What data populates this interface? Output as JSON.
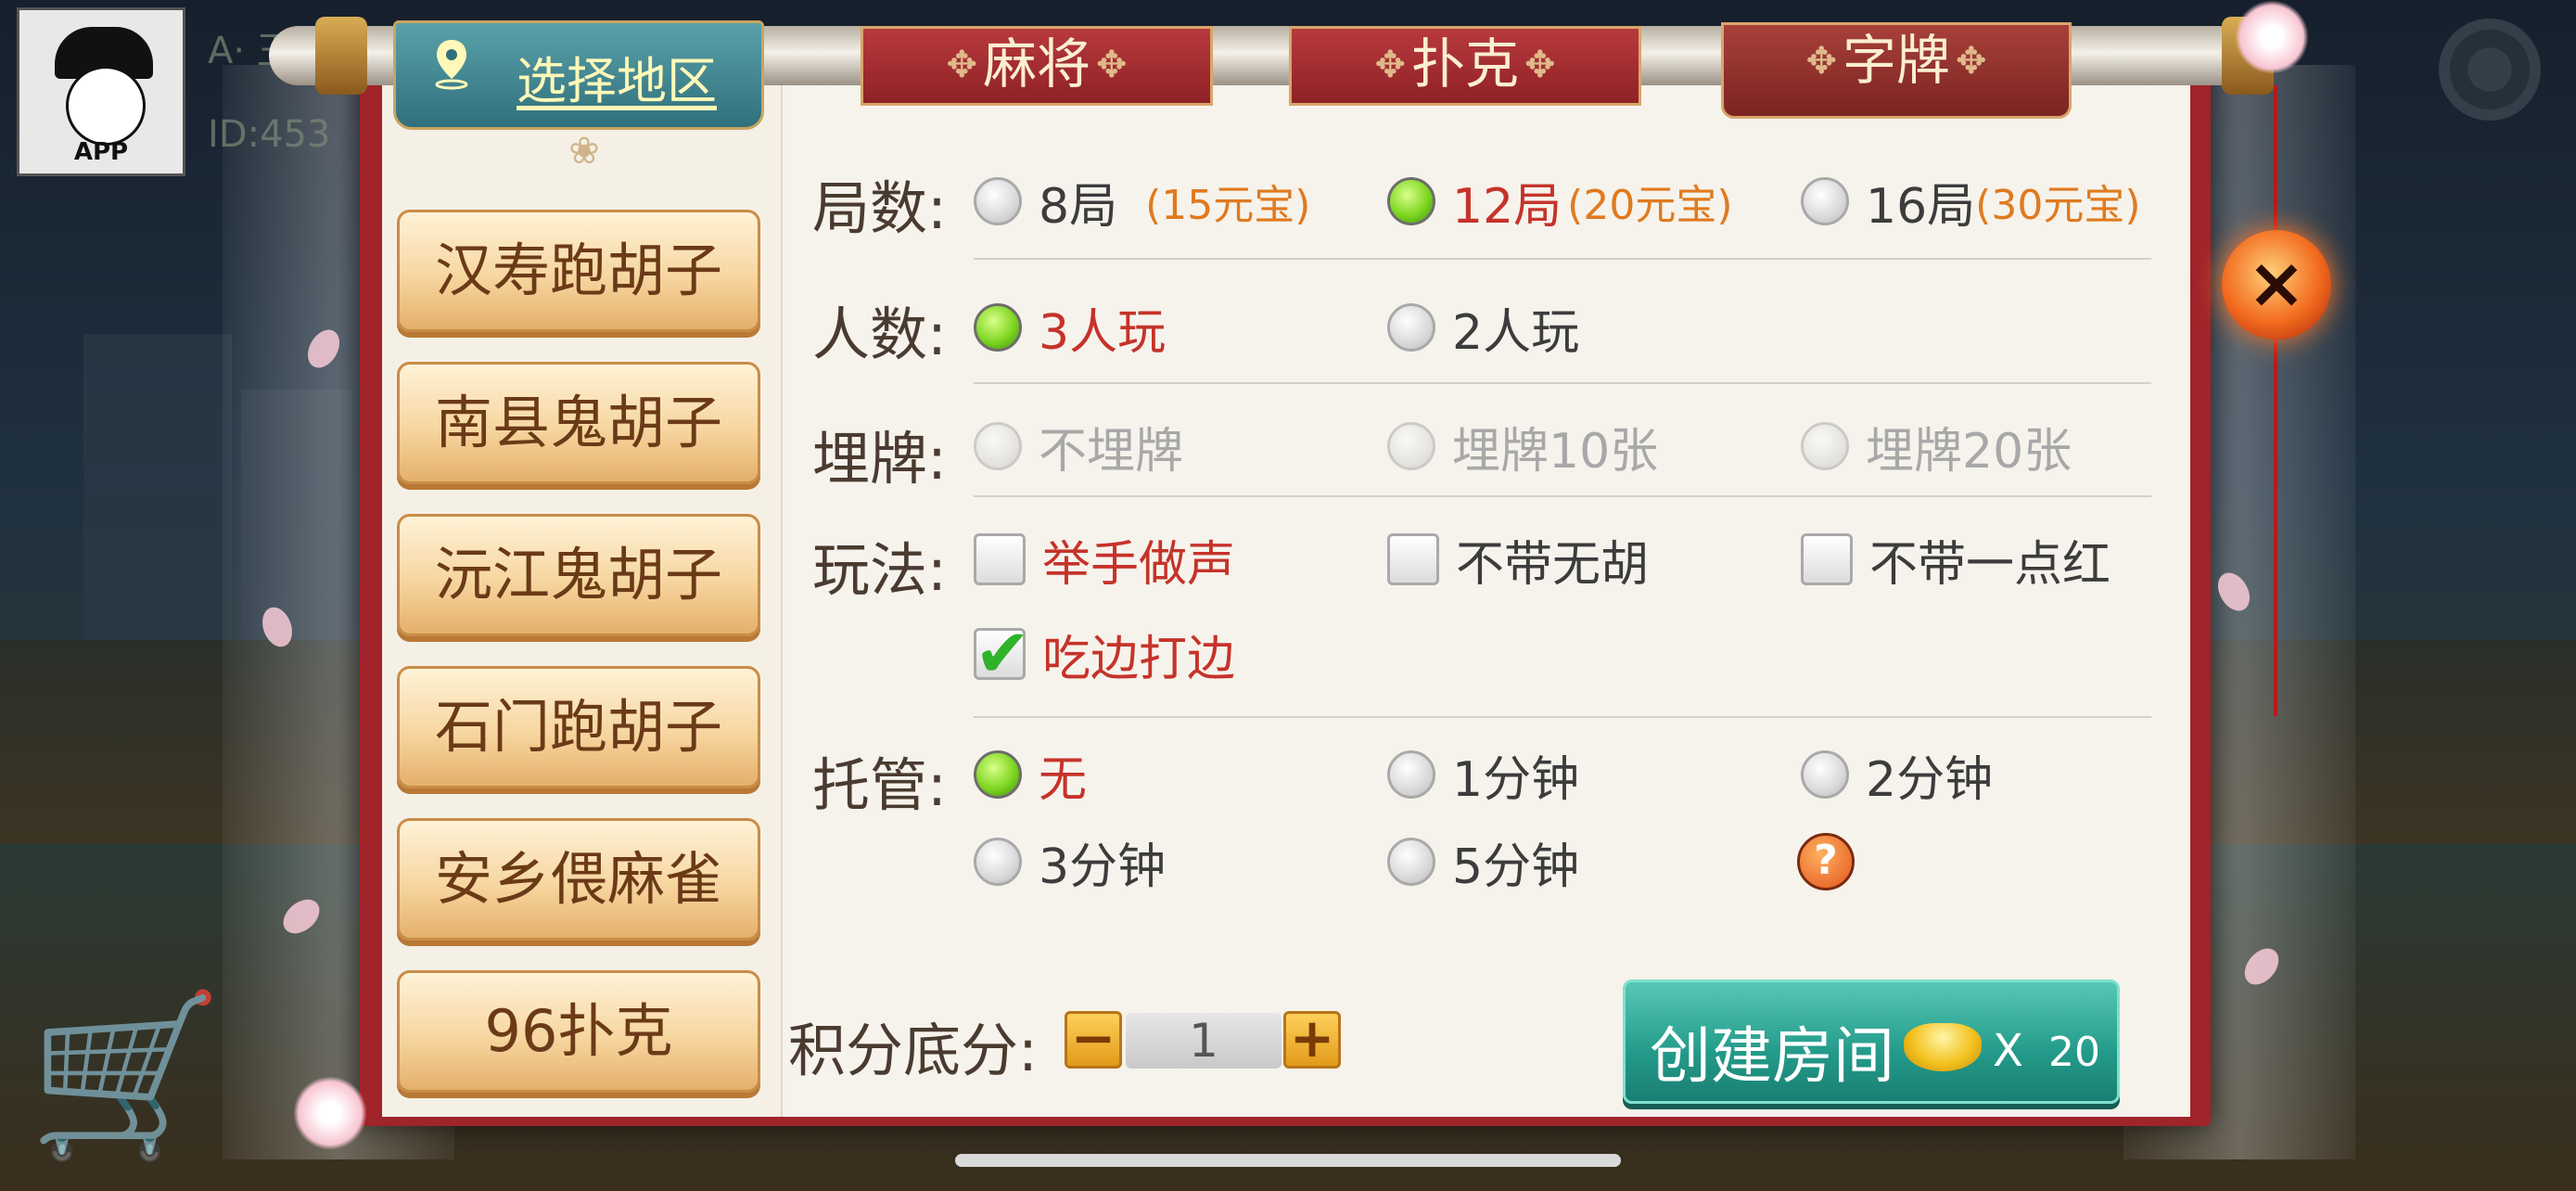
{
  "player": {
    "name_fragment": "A· 王",
    "id_fragment": "ID:453",
    "avatar_brand": "APP"
  },
  "tabs": {
    "region": "选择地区",
    "mahjong": "麻将",
    "poker": "扑克",
    "zipai": "字牌",
    "active": "zipai"
  },
  "games": [
    "汉寿跑胡子",
    "南县鬼胡子",
    "沅江鬼胡子",
    "石门跑胡子",
    "安乡偎麻雀",
    "96扑克"
  ],
  "rounds": {
    "label": "局数:",
    "options": [
      {
        "label": "8局",
        "cost": "(15元宝)",
        "selected": false
      },
      {
        "label": "12局",
        "cost": "(20元宝)",
        "selected": true
      },
      {
        "label": "16局",
        "cost": "(30元宝)",
        "selected": false
      }
    ]
  },
  "players": {
    "label": "人数:",
    "options": [
      {
        "label": "3人玩",
        "selected": true
      },
      {
        "label": "2人玩",
        "selected": false
      }
    ]
  },
  "bury": {
    "label": "埋牌:",
    "options": [
      {
        "label": "不埋牌",
        "selected": false,
        "disabled": true
      },
      {
        "label": "埋牌10张",
        "selected": false,
        "disabled": true
      },
      {
        "label": "埋牌20张",
        "selected": false,
        "disabled": true
      }
    ]
  },
  "rules": {
    "label": "玩法:",
    "options": [
      {
        "label": "举手做声",
        "checked": false
      },
      {
        "label": "不带无胡",
        "checked": false
      },
      {
        "label": "不带一点红",
        "checked": false
      },
      {
        "label": "吃边打边",
        "checked": true
      }
    ]
  },
  "trustee": {
    "label": "托管:",
    "options": [
      {
        "label": "无",
        "selected": true
      },
      {
        "label": "1分钟",
        "selected": false
      },
      {
        "label": "2分钟",
        "selected": false
      },
      {
        "label": "3分钟",
        "selected": false
      },
      {
        "label": "5分钟",
        "selected": false
      }
    ],
    "help": "?"
  },
  "score": {
    "label": "积分底分:",
    "value": "1",
    "minus": "−",
    "plus": "+"
  },
  "create": {
    "label": "创建房间",
    "times": "X",
    "cost": "20"
  },
  "close": "×",
  "colors": {
    "frame": "#a0242a",
    "selected_text": "#c5332a",
    "cost_text": "#e07a1f",
    "create_button": "#239a89"
  }
}
